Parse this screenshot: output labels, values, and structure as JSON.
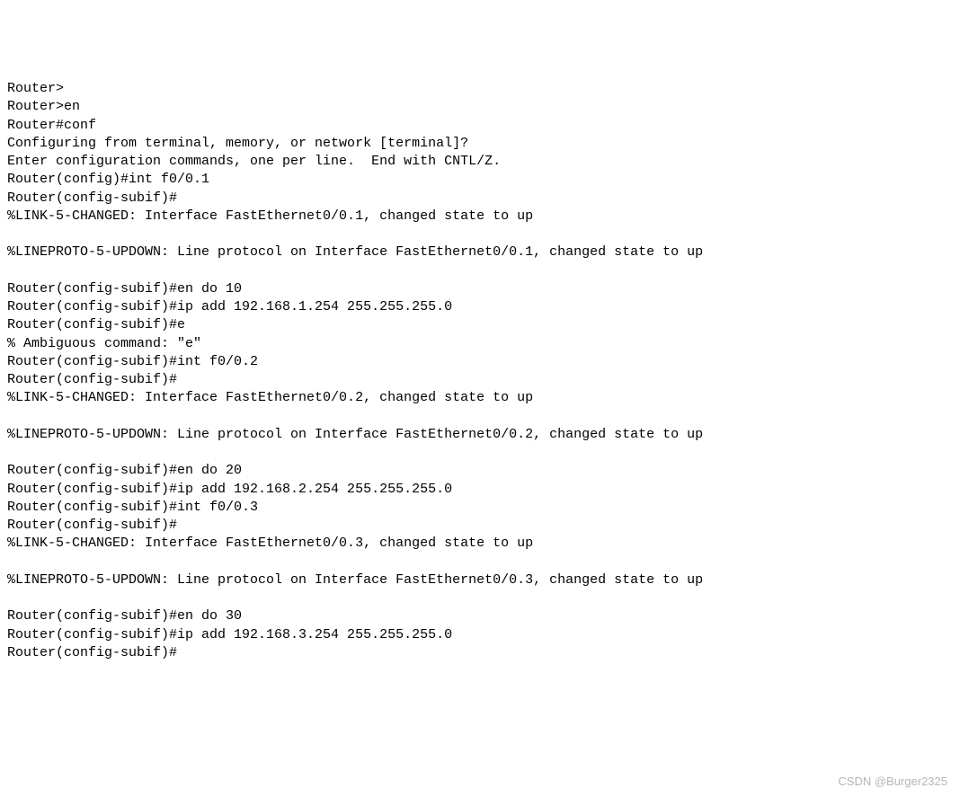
{
  "terminal": {
    "lines": [
      "Router>",
      "Router>en",
      "Router#conf",
      "Configuring from terminal, memory, or network [terminal]?",
      "Enter configuration commands, one per line.  End with CNTL/Z.",
      "Router(config)#int f0/0.1",
      "Router(config-subif)#",
      "%LINK-5-CHANGED: Interface FastEthernet0/0.1, changed state to up",
      "",
      "%LINEPROTO-5-UPDOWN: Line protocol on Interface FastEthernet0/0.1, changed state to up",
      "",
      "Router(config-subif)#en do 10",
      "Router(config-subif)#ip add 192.168.1.254 255.255.255.0",
      "Router(config-subif)#e",
      "% Ambiguous command: \"e\"",
      "Router(config-subif)#int f0/0.2",
      "Router(config-subif)#",
      "%LINK-5-CHANGED: Interface FastEthernet0/0.2, changed state to up",
      "",
      "%LINEPROTO-5-UPDOWN: Line protocol on Interface FastEthernet0/0.2, changed state to up",
      "",
      "Router(config-subif)#en do 20",
      "Router(config-subif)#ip add 192.168.2.254 255.255.255.0",
      "Router(config-subif)#int f0/0.3",
      "Router(config-subif)#",
      "%LINK-5-CHANGED: Interface FastEthernet0/0.3, changed state to up",
      "",
      "%LINEPROTO-5-UPDOWN: Line protocol on Interface FastEthernet0/0.3, changed state to up",
      "",
      "Router(config-subif)#en do 30",
      "Router(config-subif)#ip add 192.168.3.254 255.255.255.0",
      "Router(config-subif)#"
    ]
  },
  "watermark": "CSDN @Burger2325"
}
